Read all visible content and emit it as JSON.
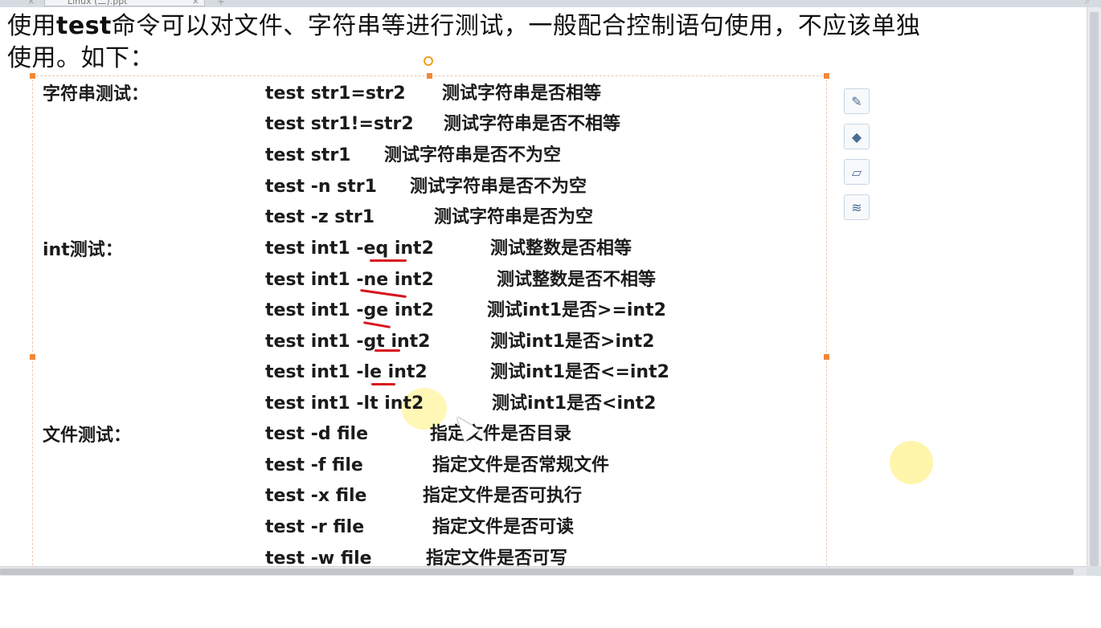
{
  "tab": {
    "title": "Linux (二).ppt",
    "close": "×",
    "add": "+"
  },
  "heading": {
    "pre": "使用",
    "bold": "test",
    "post": "命令可以对文件、字符串等进行测试，一般配合控制语句使用，不应该单独",
    "line2": "使用。如下："
  },
  "sections": {
    "string": "字符串测试：",
    "int": "int测试：",
    "file": "文件测试："
  },
  "rows": [
    {
      "cmd": "test  str1=str2",
      "desc": "测试字符串是否相等"
    },
    {
      "cmd": "test  str1!=str2",
      "desc": "测试字符串是否不相等"
    },
    {
      "cmd": "test  str1",
      "desc": "测试字符串是否不为空"
    },
    {
      "cmd": "test  -n str1",
      "desc": "测试字符串是否不为空"
    },
    {
      "cmd": "test  -z  str1",
      "desc": "测试字符串是否为空"
    },
    {
      "cmd": "test   int1 -eq  int2",
      "desc": "测试整数是否相等"
    },
    {
      "cmd": "test   int1 -ne  int2",
      "desc": "测试整数是否不相等"
    },
    {
      "cmd": "test   int1 -ge  int2",
      "desc": "测试int1是否>=int2"
    },
    {
      "cmd": "test   int1 -gt int2",
      "desc": "测试int1是否>int2"
    },
    {
      "cmd": "test   int1 -le int2",
      "desc": "测试int1是否<=int2"
    },
    {
      "cmd": "test   int1 -lt  int2",
      "desc": "测试int1是否<int2"
    },
    {
      "cmd": "test  -d  file",
      "desc": "指定文件是否目录"
    },
    {
      "cmd": "test  -f  file",
      "desc": "指定文件是否常规文件"
    },
    {
      "cmd": "test  -x  file",
      "desc": "指定文件是否可执行"
    },
    {
      "cmd": "test  -r  file",
      "desc": "指定文件是否可读"
    },
    {
      "cmd": "test  -w  file",
      "desc": "指定文件是否可写"
    }
  ],
  "tools": [
    "edit-shape-icon",
    "fill-color-icon",
    "outline-color-icon",
    "layers-icon"
  ],
  "colors": {
    "underline": "#d8141e",
    "handle": "#f0883a",
    "highlight": "#fff07a"
  }
}
